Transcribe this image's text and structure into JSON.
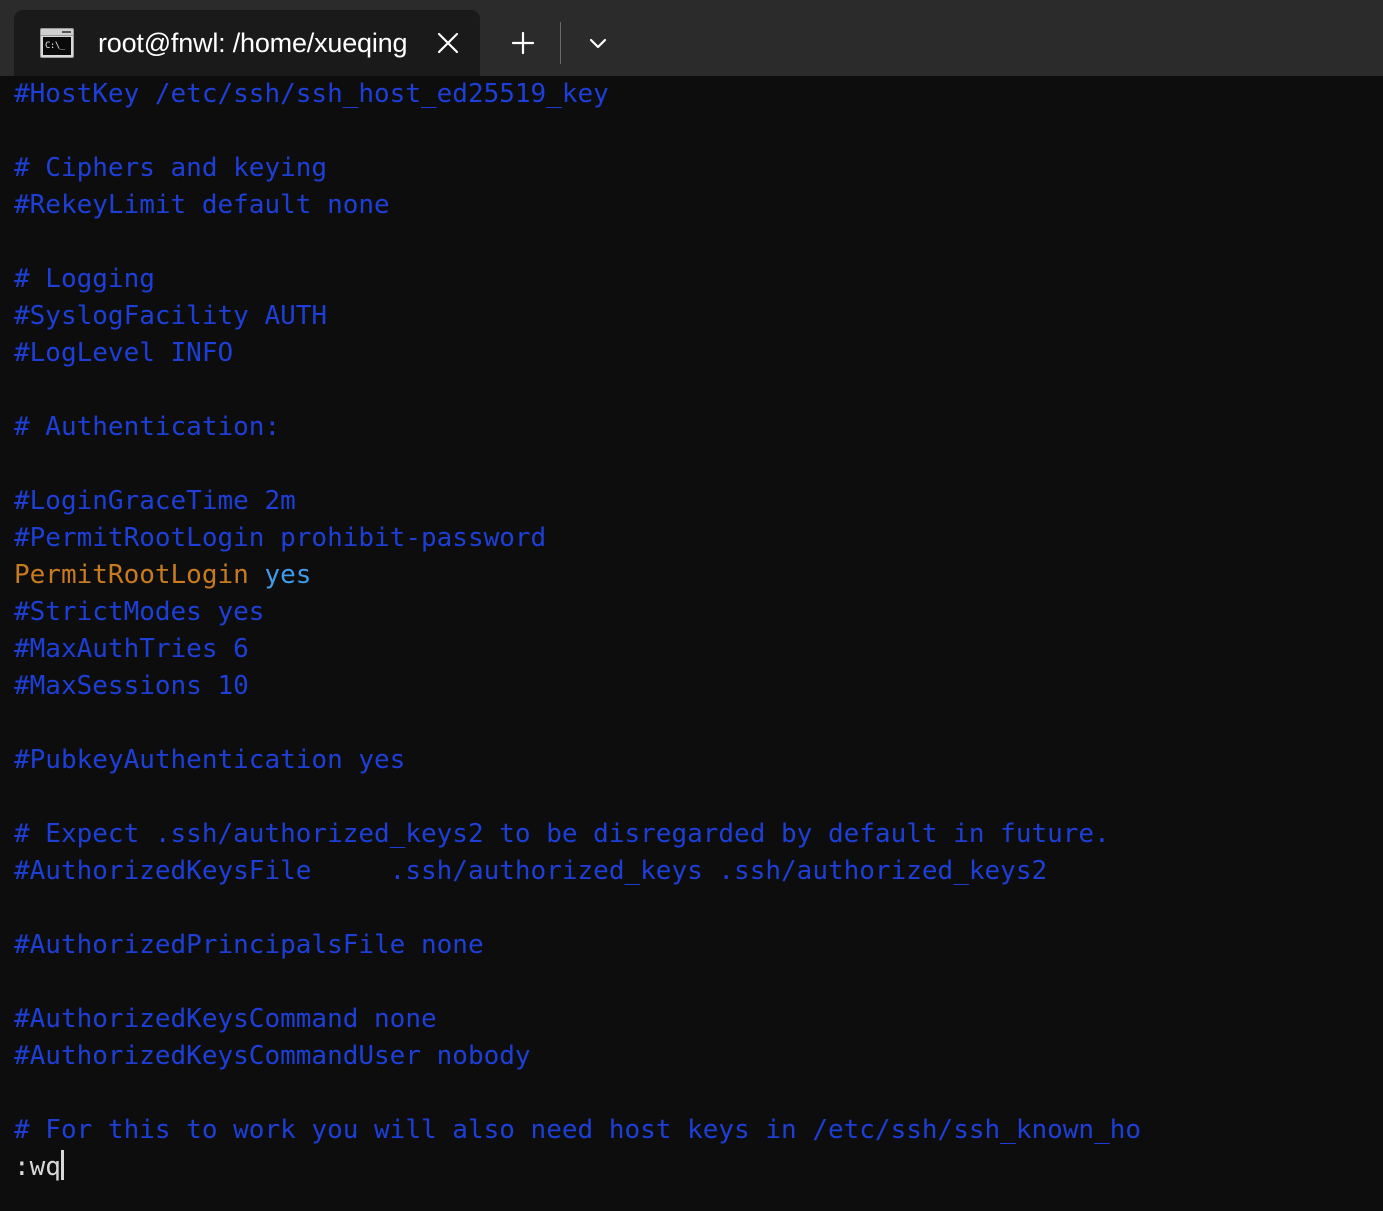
{
  "window": {
    "tabbar": {
      "tab": {
        "icon_name": "console-icon",
        "icon_text": "C:\\_",
        "title": "root@fnwl: /home/xueqing",
        "close_label": "Close tab"
      },
      "new_tab_label": "New tab",
      "dropdown_label": "Open dropdown"
    },
    "colors": {
      "tabbar_bg": "#2b2b2b",
      "tab_active_bg": "#1a1a1a",
      "terminal_bg": "#0d0d0d",
      "comment": "#1d3fd8",
      "keyword": "#c87a1e",
      "value": "#3f9be8",
      "status_text": "#d8d8d8"
    }
  },
  "terminal": {
    "editor": "vi",
    "lines": [
      {
        "text": "#HostKey /etc/ssh/ssh_host_ed25519_key",
        "style": "comment"
      },
      {
        "text": "",
        "style": "comment"
      },
      {
        "text": "# Ciphers and keying",
        "style": "comment"
      },
      {
        "text": "#RekeyLimit default none",
        "style": "comment"
      },
      {
        "text": "",
        "style": "comment"
      },
      {
        "text": "# Logging",
        "style": "comment"
      },
      {
        "text": "#SyslogFacility AUTH",
        "style": "comment"
      },
      {
        "text": "#LogLevel INFO",
        "style": "comment"
      },
      {
        "text": "",
        "style": "comment"
      },
      {
        "text": "# Authentication:",
        "style": "comment"
      },
      {
        "text": "",
        "style": "comment"
      },
      {
        "text": "#LoginGraceTime 2m",
        "style": "comment"
      },
      {
        "text": "#PermitRootLogin prohibit-password",
        "style": "comment"
      },
      {
        "text": "PermitRootLogin yes",
        "style": "directive",
        "keyword": "PermitRootLogin",
        "value": " yes"
      },
      {
        "text": "#StrictModes yes",
        "style": "comment"
      },
      {
        "text": "#MaxAuthTries 6",
        "style": "comment"
      },
      {
        "text": "#MaxSessions 10",
        "style": "comment"
      },
      {
        "text": "",
        "style": "comment"
      },
      {
        "text": "#PubkeyAuthentication yes",
        "style": "comment"
      },
      {
        "text": "",
        "style": "comment"
      },
      {
        "text": "# Expect .ssh/authorized_keys2 to be disregarded by default in future.",
        "style": "comment"
      },
      {
        "text": "#AuthorizedKeysFile     .ssh/authorized_keys .ssh/authorized_keys2",
        "style": "comment"
      },
      {
        "text": "",
        "style": "comment"
      },
      {
        "text": "#AuthorizedPrincipalsFile none",
        "style": "comment"
      },
      {
        "text": "",
        "style": "comment"
      },
      {
        "text": "#AuthorizedKeysCommand none",
        "style": "comment"
      },
      {
        "text": "#AuthorizedKeysCommandUser nobody",
        "style": "comment"
      },
      {
        "text": "",
        "style": "comment"
      },
      {
        "text": "# For this to work you will also need host keys in /etc/ssh/ssh_known_ho",
        "style": "comment"
      }
    ],
    "status_line": {
      "command": ":wq",
      "cursor_visible": true
    }
  }
}
